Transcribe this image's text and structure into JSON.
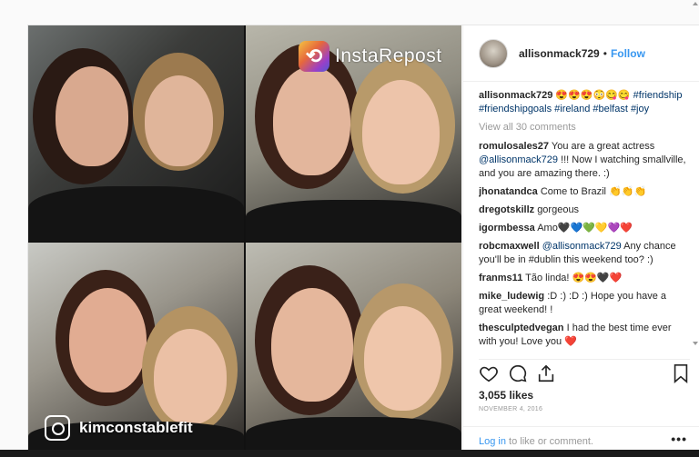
{
  "overlay": {
    "repost_label": "InstaRepost",
    "credit_username": "kimconstablefit"
  },
  "header": {
    "username": "allisonmack729",
    "separator": "•",
    "follow_label": "Follow"
  },
  "caption": {
    "username": "allisonmack729",
    "emojis": "😍😍😍😳😋😋",
    "hashtags": "#friendship #friendshipgoals #ireland #belfast #joy"
  },
  "view_all_label": "View all 30 comments",
  "comments": [
    {
      "user": "romulosales27",
      "text": "You are a great actress ",
      "mention": "@allisonmack729",
      "text2": " !!! Now I watching smallville, and you are amazing there. :)"
    },
    {
      "user": "jhonatandca",
      "text": "Come to Brazil 👏👏👏",
      "mention": "",
      "text2": ""
    },
    {
      "user": "dregotskillz",
      "text": "gorgeous",
      "mention": "",
      "text2": ""
    },
    {
      "user": "igormbessa",
      "text": "Amo🖤💙💚💛💜❤️",
      "mention": "",
      "text2": ""
    },
    {
      "user": "robcmaxwell",
      "text": "",
      "mention": "@allisonmack729",
      "text2": " Any chance you'll be in #dublin this weekend too? :)"
    },
    {
      "user": "franms11",
      "text": "Tão linda! 😍😍🖤❤️",
      "mention": "",
      "text2": ""
    },
    {
      "user": "mike_ludewig",
      "text": ":D :) :D :) Hope you have a great weekend! !",
      "mention": "",
      "text2": ""
    },
    {
      "user": "thesculptedvegan",
      "text": "I had the best time ever with you! Love you ❤️",
      "mention": "",
      "text2": ""
    }
  ],
  "likes_label": "3,055 likes",
  "date_label": "NOVEMBER 4, 2016",
  "login": {
    "link_label": "Log in",
    "rest_label": " to like or comment.",
    "more_label": "•••"
  },
  "colors": {
    "accent": "#3897f0",
    "text": "#262626",
    "muted": "#999999"
  },
  "icons": [
    "heart-icon",
    "comment-icon",
    "share-icon",
    "bookmark-icon",
    "instarepost-logo-icon",
    "instagram-logo-icon"
  ]
}
